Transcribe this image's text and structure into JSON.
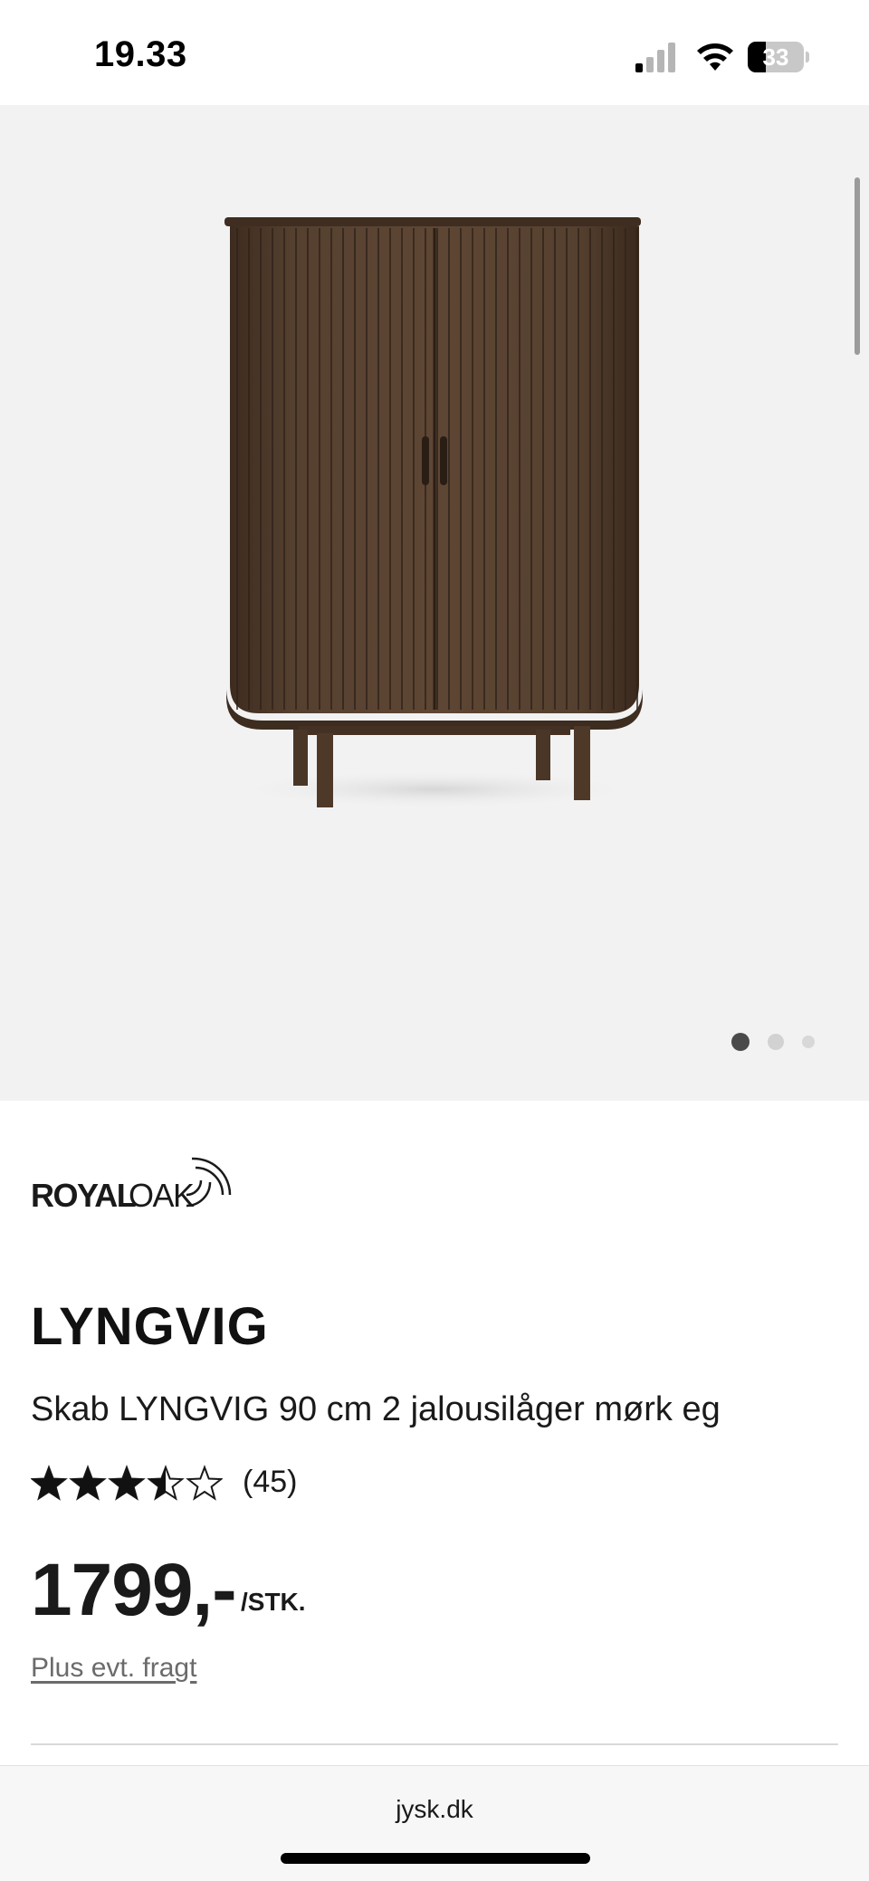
{
  "status_bar": {
    "time": "19.33",
    "battery_level": "33",
    "battery_fraction": 0.33
  },
  "gallery": {
    "image_name": "cabinet-dark-oak",
    "slide_count": 3,
    "active_slide": 1
  },
  "product": {
    "brand": {
      "royal": "ROYAL",
      "oak": "OAK"
    },
    "title": "LYNGVIG",
    "subtitle": "Skab LYNGVIG 90 cm 2 jalousilåger mørk eg",
    "rating": {
      "stars": 3.5,
      "max_stars": 5,
      "count_label": "(45)"
    },
    "price": {
      "value": "1799,-",
      "unit": "/STK."
    },
    "shipping_link": "Plus evt. fragt"
  },
  "browser": {
    "url": "jysk.dk"
  },
  "colors": {
    "gallery_bg": "#f2f2f2",
    "wood_dark": "#4a3628",
    "wood_mid": "#5c4433",
    "text": "#1a1a1a",
    "muted_link": "#6b6b6b"
  }
}
